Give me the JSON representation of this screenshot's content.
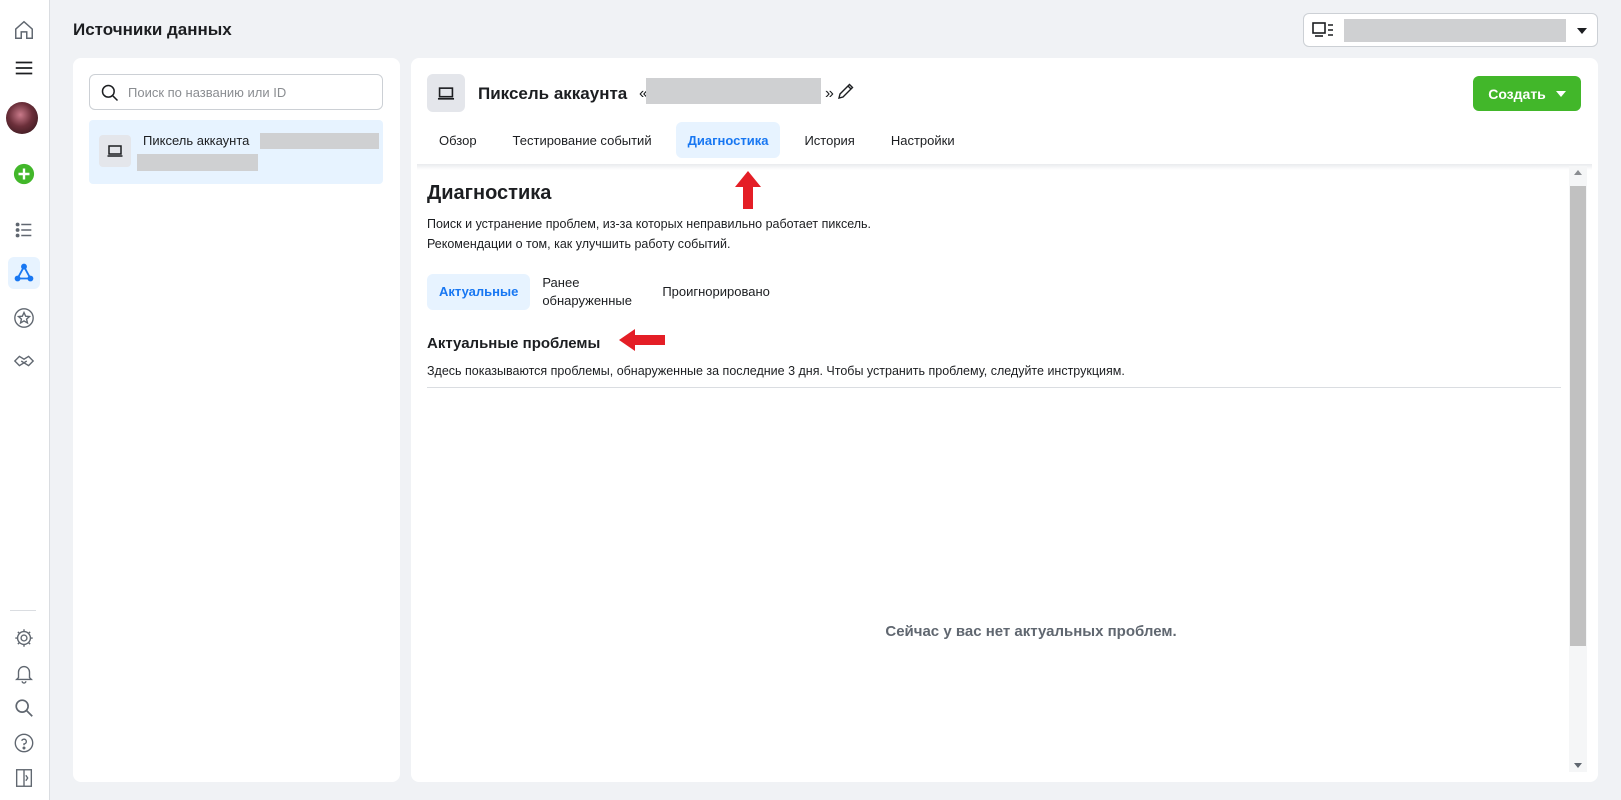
{
  "header": {
    "title": "Источники данных"
  },
  "sidebar": {
    "search_placeholder": "Поиск по названию или ID",
    "items": [
      {
        "name": "Пиксель аккаунта"
      }
    ]
  },
  "main": {
    "pixel_title": "Пиксель аккаунта",
    "pixel_quote_open": "«",
    "pixel_quote_close": "»",
    "create_label": "Создать",
    "tabs": [
      {
        "label": "Обзор"
      },
      {
        "label": "Тестирование событий"
      },
      {
        "label": "Диагностика",
        "active": true
      },
      {
        "label": "История"
      },
      {
        "label": "Настройки"
      }
    ],
    "section_title": "Диагностика",
    "section_desc_1": "Поиск и устранение проблем, из-за которых неправильно работает пиксель.",
    "section_desc_2": "Рекомендации о том, как улучшить работу событий.",
    "subtabs": [
      {
        "label": "Актуальные",
        "active": true
      },
      {
        "label": "Ранее обнаруженные"
      },
      {
        "label": "Проигнорировано"
      }
    ],
    "issues_title": "Актуальные проблемы",
    "issues_desc": "Здесь показываются проблемы, обнаруженные за последние 3 дня. Чтобы устранить проблему, следуйте инструкциям.",
    "empty_message": "Сейчас у вас нет актуальных проблем."
  },
  "colors": {
    "accent": "#1877f2",
    "create_button": "#42b72a",
    "annotation_arrow": "#e41e26",
    "active_tab_bg": "#e7f3ff"
  },
  "icons": {
    "rail": [
      "home-icon",
      "menu-icon",
      "avatar",
      "plus-circle-icon",
      "list-icon",
      "events-manager-icon",
      "star-icon",
      "handshake-icon",
      "gear-icon",
      "bell-icon",
      "search-icon",
      "help-icon",
      "panel-icon"
    ],
    "pixel": "monitor-icon",
    "edit": "pencil-icon"
  }
}
